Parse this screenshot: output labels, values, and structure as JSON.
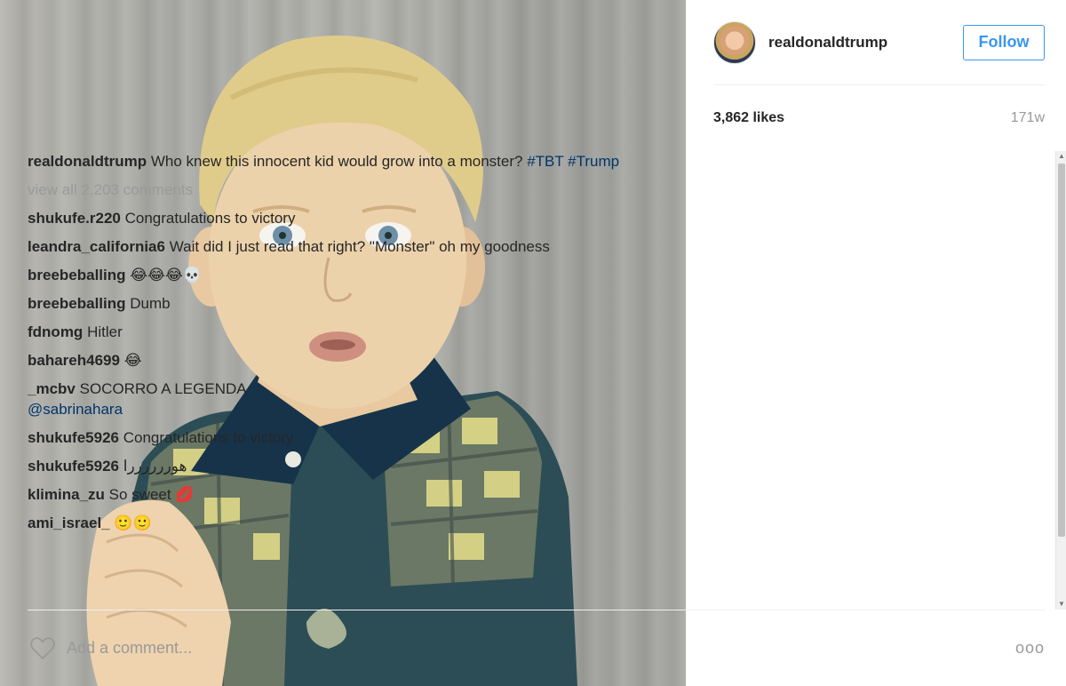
{
  "post": {
    "author": "realdonaldtrump",
    "follow_label": "Follow",
    "likes": "3,862 likes",
    "age": "171w",
    "caption": {
      "username": "realdonaldtrump",
      "text": "Who knew this innocent kid would grow into a monster?",
      "hashtags": "#TBT #Trump"
    },
    "view_all": "view all 2,203 comments",
    "comments": [
      {
        "username": "shukufe.r220",
        "text": "Congratulations to victory"
      },
      {
        "username": "leandra_california6",
        "text": "Wait did I just read that right? \"Monster\" oh my goodness"
      },
      {
        "username": "breebeballing",
        "text": "😂😂😂💀"
      },
      {
        "username": "breebeballing",
        "text": "Dumb"
      },
      {
        "username": "fdnomg",
        "text": "Hitler"
      },
      {
        "username": "bahareh4699",
        "text": "😂"
      },
      {
        "username": "_mcbv",
        "text": "SOCORRO A LEGENDA",
        "mention": "@sabrinahara"
      },
      {
        "username": "shukufe5926",
        "text": "Congratulations to victory"
      },
      {
        "username": "shukufe5926",
        "text": "هوررررررا"
      },
      {
        "username": "klimina_zu",
        "text": "So sweet 💋"
      },
      {
        "username": "ami_israel_",
        "text": "🙂🙂"
      }
    ],
    "add_comment_placeholder": "Add a comment...",
    "more_label": "ooo"
  },
  "icons": {
    "heart": "heart-outline-icon",
    "more": "more-options-icon",
    "avatar": "profile-avatar"
  },
  "colors": {
    "link_blue": "#3897f0",
    "hashtag_blue": "#003569",
    "muted_gray": "#999999"
  }
}
